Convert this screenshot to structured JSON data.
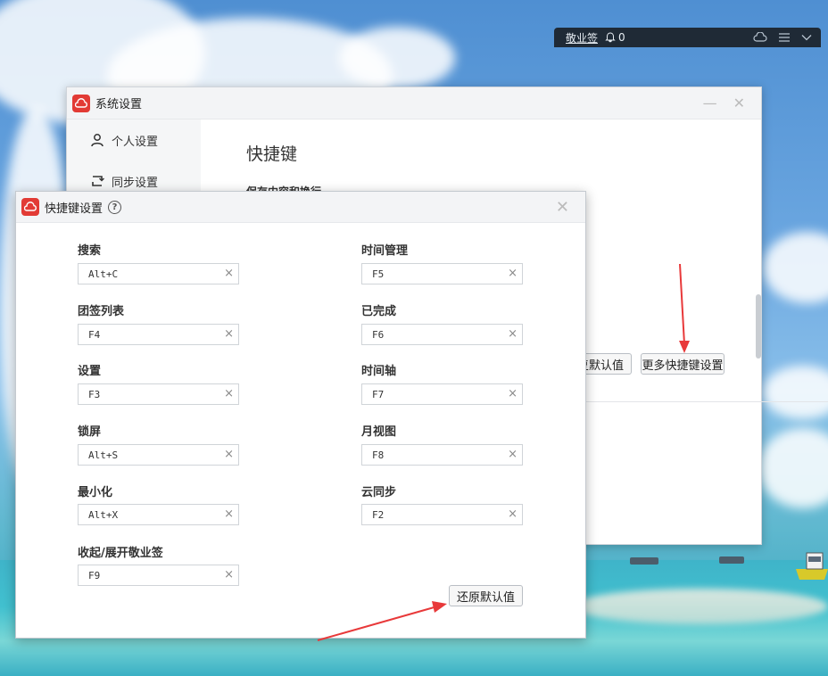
{
  "widget": {
    "app_name": "敬业签",
    "notification_count": "0",
    "icons": [
      "bell-icon",
      "cloud-icon",
      "menu-icon",
      "chevron-down-icon"
    ]
  },
  "system_settings": {
    "title": "系统设置",
    "sidebar": [
      {
        "label": "个人设置",
        "icon": "user-icon"
      },
      {
        "label": "同步设置",
        "icon": "sync-icon"
      }
    ],
    "heading": "快捷键",
    "subheading": "保存内容和换行",
    "restore_default_partial": "复默认值",
    "more_shortcuts_button": "更多快捷键设置"
  },
  "shortcut_dialog": {
    "title": "快捷键设置",
    "left_column": [
      {
        "label": "搜索",
        "value": "Alt+C"
      },
      {
        "label": "团签列表",
        "value": "F4"
      },
      {
        "label": "设置",
        "value": "F3"
      },
      {
        "label": "锁屏",
        "value": "Alt+S"
      },
      {
        "label": "最小化",
        "value": "Alt+X"
      },
      {
        "label": "收起/展开敬业签",
        "value": "F9"
      }
    ],
    "right_column": [
      {
        "label": "时间管理",
        "value": "F5"
      },
      {
        "label": "已完成",
        "value": "F6"
      },
      {
        "label": "时间轴",
        "value": "F7"
      },
      {
        "label": "月视图",
        "value": "F8"
      },
      {
        "label": "云同步",
        "value": "F2"
      }
    ],
    "restore_default_button": "还原默认值",
    "clear_glyph": "×"
  },
  "colors": {
    "brand_red": "#e23b35",
    "annotation_arrow": "#e8393a",
    "widget_bg": "#1f2a36"
  }
}
